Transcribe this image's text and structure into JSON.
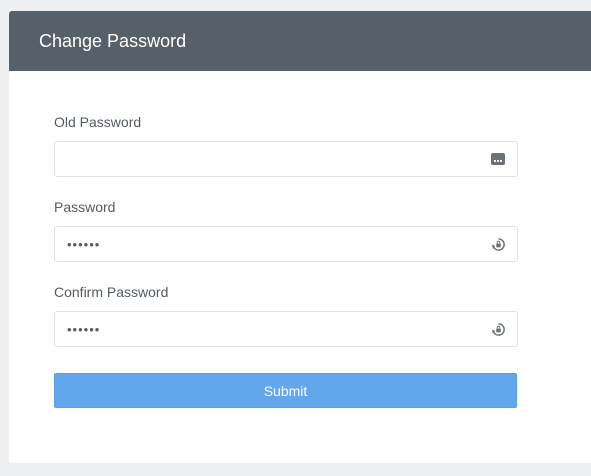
{
  "header": {
    "title": "Change Password"
  },
  "form": {
    "old_password": {
      "label": "Old Password",
      "value": "",
      "icon": "password-manager-key-icon"
    },
    "password": {
      "label": "Password",
      "value": "••••••",
      "icon": "password-generator-icon"
    },
    "confirm_password": {
      "label": "Confirm Password",
      "value": "••••••",
      "icon": "password-generator-icon"
    },
    "submit_label": "Submit"
  },
  "colors": {
    "header_bg": "#566069",
    "submit_bg": "#62a6ec",
    "page_bg": "#eef0f2"
  }
}
